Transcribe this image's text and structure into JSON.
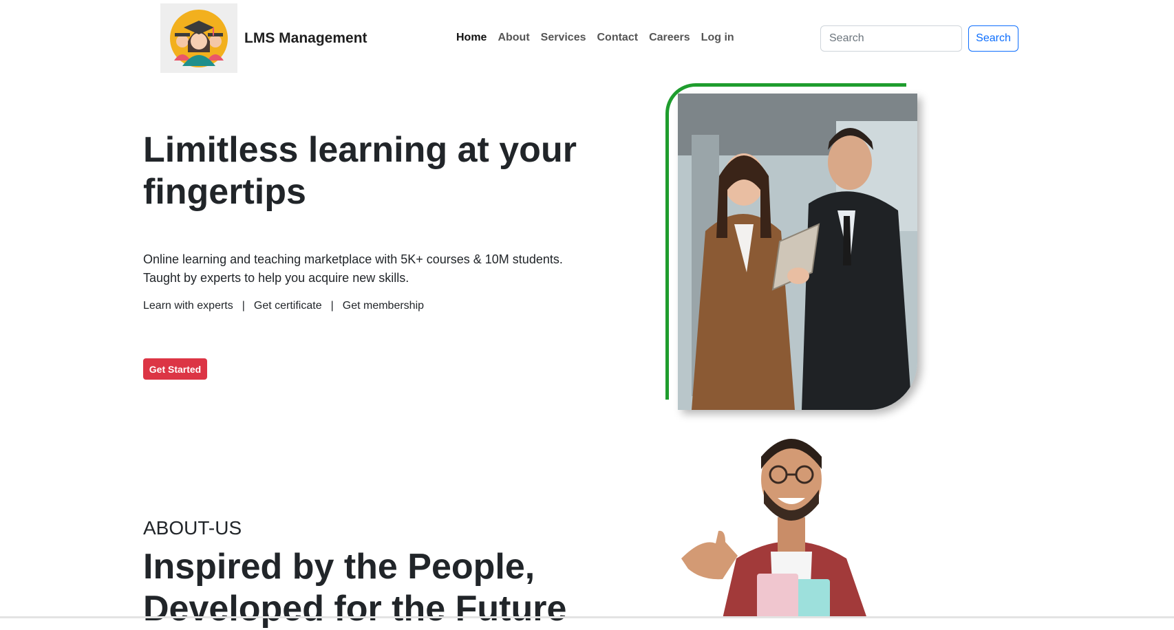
{
  "header": {
    "brand": "LMS Management",
    "nav": [
      "Home",
      "About",
      "Services",
      "Contact",
      "Careers",
      "Log in"
    ],
    "active_nav": "Home",
    "search": {
      "placeholder": "Search",
      "button_label": "Search"
    }
  },
  "hero": {
    "title": "Limitless learning at your fingertips",
    "description": "Online learning and teaching marketplace with 5K+ courses & 10M students. Taught by experts to help you acquire new skills.",
    "links": [
      "Learn with experts",
      "Get certificate",
      "Get membership"
    ],
    "separator": "|",
    "cta_label": "Get Started"
  },
  "about": {
    "kicker": "ABOUT-US",
    "title": "Inspired by the People, Developed for the Future"
  },
  "colors": {
    "frame_green": "#1f9d2e",
    "cta_red": "#dc3545",
    "search_blue": "#0d6efd"
  }
}
